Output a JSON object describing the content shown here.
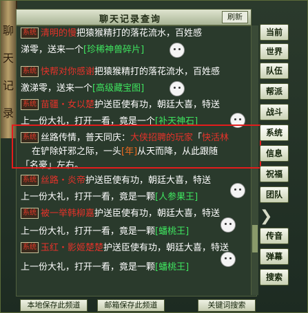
{
  "window": {
    "title": "聊天记录查询",
    "refresh_label": "刷新"
  },
  "scroll_art_chars": [
    "聊",
    "天",
    "记",
    "录"
  ],
  "side_buttons": [
    "当前",
    "世界",
    "队伍",
    "帮派",
    "战斗",
    "系统",
    "信息",
    "祝福",
    "团队",
    "传音",
    "弹幕",
    "搜索"
  ],
  "bottom_buttons": [
    "本地保存此频道",
    "邮箱保存此频道",
    "关键词搜索"
  ],
  "channel_tag": "系统",
  "messages": [
    {
      "player": "清明的慢",
      "text": "把猿猴精打的落花流水，百姓感"
    },
    {
      "cont1": "涕零，送来一个",
      "item": "[珍稀神兽碎片]"
    },
    {
      "player": "快帮对你感谢",
      "text": "把猿猴精打的落花流水，百姓感"
    },
    {
      "cont1": "激涕零，送来一个",
      "item": "[高级藏宝图]"
    },
    {
      "player": "苗疆・女以楚",
      "text": "护送臣使有功，朝廷大喜，特送"
    },
    {
      "cont1": "上一份大礼，打开一看，竟是一个",
      "item": "[补天神石]"
    },
    {
      "prefix": "丝路传情，普天同庆：",
      "player": "大侠招聘的玩家",
      "sep": "「",
      "target": "快活林",
      "line2a": "在铲除奸邪之际，一头",
      "beast": "[年]",
      "line2b": "从天而降，从此跟随",
      "line3": "「名豪」左右。"
    },
    {
      "player": "丝路・炎帝",
      "text": "护送臣使有功，朝廷大喜，特送"
    },
    {
      "cont1": "上一份大礼，打开一看，竟是一颗",
      "item": "[人参果王]"
    },
    {
      "player": "被一举韩柳嘉",
      "text": "护送臣使有功，朝廷大喜，特送"
    },
    {
      "cont1": "上一份大礼，打开一看，竟是一颗",
      "item": "[蟠桃王]"
    },
    {
      "player": "玉红・影姬楚楚",
      "text": "护送臣使有功，朝廷大喜，特送"
    },
    {
      "cont1": "上一份大礼，打开一看，竟是一颗",
      "item": "[蟠桃王]"
    }
  ]
}
